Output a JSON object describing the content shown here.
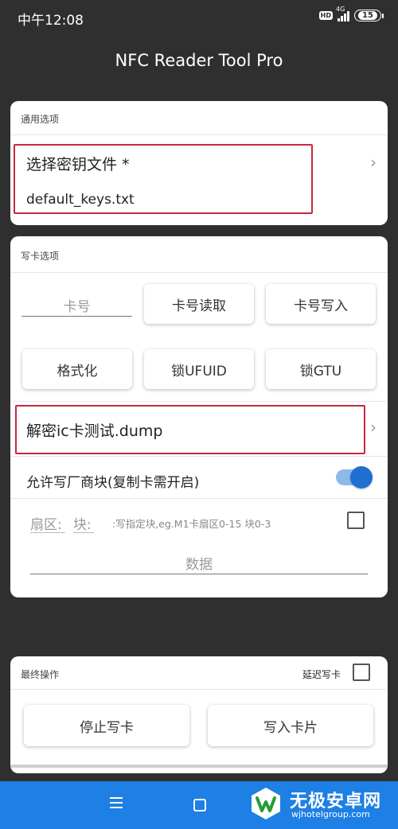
{
  "status_bar": {
    "time": "中午12:08",
    "hd": "HD",
    "network": "4G",
    "battery": "15"
  },
  "app": {
    "title": "NFC Reader Tool Pro"
  },
  "general": {
    "section_label": "通用选项",
    "key_file_label": "选择密钥文件 *",
    "key_file_value": "default_keys.txt"
  },
  "write": {
    "section_label": "写卡选项",
    "card_number_placeholder": "卡号",
    "read_card_number": "卡号读取",
    "write_card_number": "卡号写入",
    "format": "格式化",
    "lock_ufuid": "锁UFUID",
    "lock_gtu": "锁GTU",
    "dump_file": "解密ic卡测试.dump",
    "allow_vendor_block": "允许写厂商块(复制卡需开启)",
    "allow_vendor_block_enabled": true,
    "sector_label": "扇区:",
    "block_label": "块:",
    "block_hint": ":写指定块,eg.M1卡扇区0-15 块0-3",
    "data_placeholder": "数据"
  },
  "final": {
    "section_label": "最终操作",
    "delay_write_label": "延迟写卡",
    "stop_write": "停止写卡",
    "write_card": "写入卡片"
  },
  "watermark": {
    "title": "无极安卓网",
    "url": "wjhotelgroup.com"
  },
  "colors": {
    "background": "#2f2f2f",
    "accent": "#1f6fd2",
    "highlight": "#c8283d",
    "nav_bar": "#1e7fe4"
  }
}
